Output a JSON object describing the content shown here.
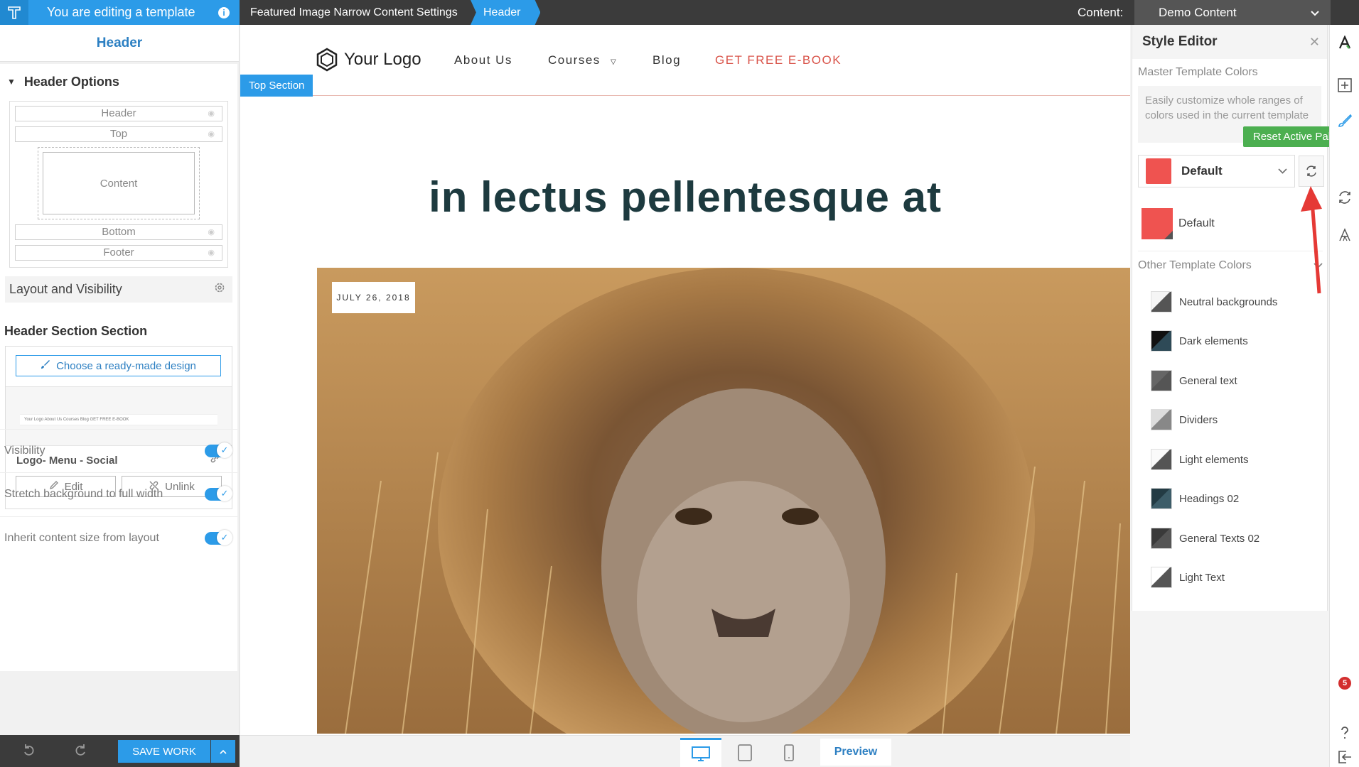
{
  "topbar": {
    "editing_label": "You are editing a template",
    "crumbs": [
      "Featured Image Narrow Content Settings",
      "Header"
    ],
    "content_label": "Content:",
    "content_value": "Demo Content"
  },
  "left_panel": {
    "title": "Header",
    "header_options": "Header Options",
    "diagram": {
      "header": "Header",
      "top": "Top",
      "content": "Content",
      "bottom": "Bottom",
      "footer": "Footer"
    },
    "layout_visibility": "Layout and Visibility",
    "section_title": "Header Section Section",
    "choose_design": "Choose a ready-made design",
    "thumb_text": "Your Logo   About Us   Courses   Blog   GET FREE E-BOOK",
    "design_name": "Logo- Menu - Social",
    "edit": "Edit",
    "unlink": "Unlink",
    "toggles": [
      {
        "label": "Visibility",
        "on": true
      },
      {
        "label": "Stretch background to full width",
        "on": true
      },
      {
        "label": "Inherit content size from layout",
        "on": true
      }
    ],
    "save": "SAVE WORK"
  },
  "canvas": {
    "logo_text": "Your Logo",
    "nav": {
      "about": "About Us",
      "courses": "Courses",
      "blog": "Blog",
      "ebook": "GET FREE E-BOOK"
    },
    "section_tag": "Top Section",
    "headline": "in lectus pellentesque at",
    "date": "JULY 26, 2018"
  },
  "devices": {
    "preview": "Preview"
  },
  "style_editor": {
    "title": "Style Editor",
    "master_title": "Master Template Colors",
    "description": "Easily customize whole ranges of colors used in the current template",
    "palette_selected": "Default",
    "tooltip": "Reset Active Palette",
    "palette_item": "Default",
    "other_title": "Other Template Colors",
    "colors": [
      {
        "name": "Neutral backgrounds",
        "base": "#f5f5f5",
        "accent": "#555555"
      },
      {
        "name": "Dark elements",
        "base": "#111111",
        "accent": "#2e4a57"
      },
      {
        "name": "General text",
        "base": "#666666",
        "accent": "#555555"
      },
      {
        "name": "Dividers",
        "base": "#dddddd",
        "accent": "#888888"
      },
      {
        "name": "Light elements",
        "base": "#fafafa",
        "accent": "#555555"
      },
      {
        "name": "Headings 02",
        "base": "#233b44",
        "accent": "#3d5d69"
      },
      {
        "name": "General Texts 02",
        "base": "#3a3a3a",
        "accent": "#555555"
      },
      {
        "name": "Light Text",
        "base": "#ffffff",
        "accent": "#555555"
      }
    ]
  },
  "right_bar": {
    "notification_count": "5"
  },
  "colors": {
    "accent_blue": "#2c9be8",
    "palette_red": "#ef5350",
    "tooltip_green": "#4caf50",
    "headline": "#1d3a3f",
    "ebook": "#d9544a"
  }
}
